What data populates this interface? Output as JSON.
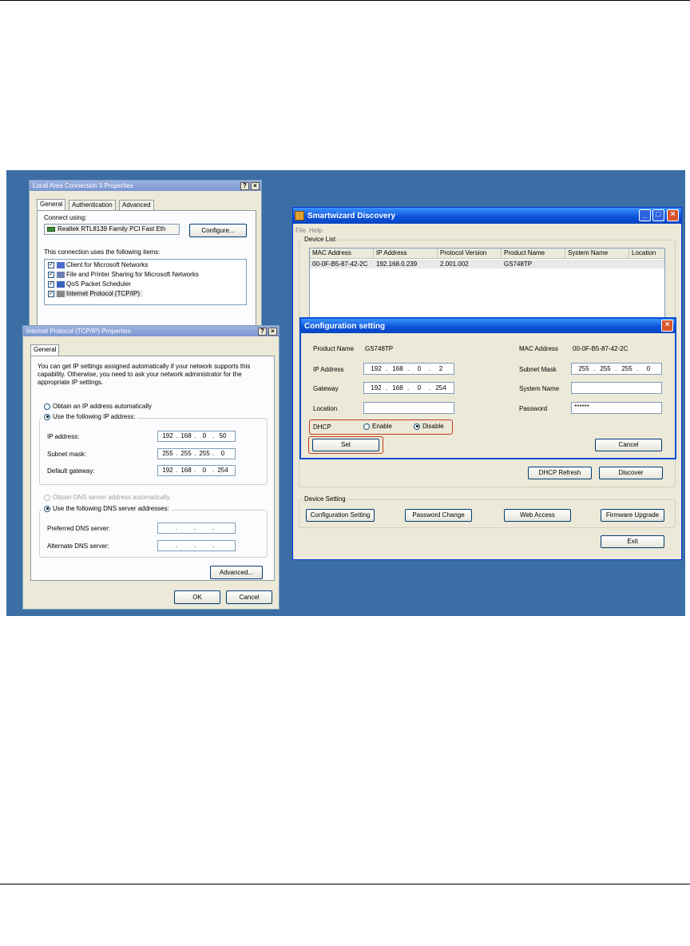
{
  "lan_window": {
    "title": "Local Area Connection 3 Properties",
    "tabs": [
      "General",
      "Authentication",
      "Advanced"
    ],
    "connect_using_label": "Connect using:",
    "adapter_name": "Realtek RTL8139 Family PCI Fast Eth",
    "configure_label": "Configure...",
    "items_label": "This connection uses the following items:",
    "items": [
      {
        "label": "Client for Microsoft Networks"
      },
      {
        "label": "File and Printer Sharing for Microsoft Networks"
      },
      {
        "label": "QoS Packet Scheduler"
      },
      {
        "label": "Internet Protocol (TCP/IP)"
      }
    ]
  },
  "tcpip_window": {
    "title": "Internet Protocol (TCP/IP) Properties",
    "tab": "General",
    "description": "You can get IP settings assigned automatically if your network supports this capability. Otherwise, you need to ask your network administrator for the appropriate IP settings.",
    "obtain_ip_auto": "Obtain an IP address automatically",
    "use_following_ip": "Use the following IP address:",
    "ip_address_label": "IP address:",
    "ip_address": [
      "192",
      "168",
      "0",
      "50"
    ],
    "subnet_label": "Subnet mask:",
    "subnet": [
      "255",
      "255",
      "255",
      "0"
    ],
    "gateway_label": "Default gateway:",
    "gateway": [
      "192",
      "168",
      "0",
      "254"
    ],
    "obtain_dns_auto": "Obtain DNS server address automatically",
    "use_following_dns": "Use the following DNS server addresses:",
    "preferred_dns_label": "Preferred DNS server:",
    "alternate_dns_label": "Alternate DNS server:",
    "advanced_label": "Advanced...",
    "ok_label": "OK",
    "cancel_label": "Cancel"
  },
  "smartwizard": {
    "title": "Smartwizard Discovery",
    "menu": [
      "File",
      "Help"
    ],
    "device_list_label": "Device List",
    "columns": [
      "MAC Address",
      "IP Address",
      "Protocol Version",
      "Product Name",
      "System Name",
      "Location"
    ],
    "row": [
      "00-0F-B5-87-42-2C",
      "192.168.0.239",
      "2.001.002",
      "GS748TP",
      "",
      ""
    ],
    "dhcp_refresh_label": "DHCP Refresh",
    "discover_label": "Discover",
    "device_setting_label": "Device Setting",
    "configuration_setting_label": "Configuration Setting",
    "password_change_label": "Password Change",
    "web_access_label": "Web Access",
    "firmware_upgrade_label": "Firmware Upgrade",
    "exit_label": "Exit"
  },
  "config_dialog": {
    "title": "Configuration setting",
    "product_name_label": "Product Name",
    "product_name": "GS748TP",
    "mac_label": "MAC Address",
    "mac": "00-0F-B5-87-42-2C",
    "ip_label": "IP Address",
    "ip": [
      "192",
      "168",
      "0",
      "2"
    ],
    "subnet_label": "Subnet Mask",
    "subnet": [
      "255",
      "255",
      "255",
      "0"
    ],
    "gateway_label": "Gateway",
    "gateway": [
      "192",
      "168",
      "0",
      "254"
    ],
    "system_name_label": "System Name",
    "location_label": "Location",
    "password_label": "Password",
    "password": "******",
    "dhcp_label": "DHCP",
    "enable_label": "Enable",
    "disable_label": "Disable",
    "set_label": "Set",
    "cancel_label": "Cancel"
  },
  "colors": {
    "desktop": "#3a6ea5",
    "highlight_box": "#c33d1e",
    "titlebar_active": "#0a50d8"
  }
}
